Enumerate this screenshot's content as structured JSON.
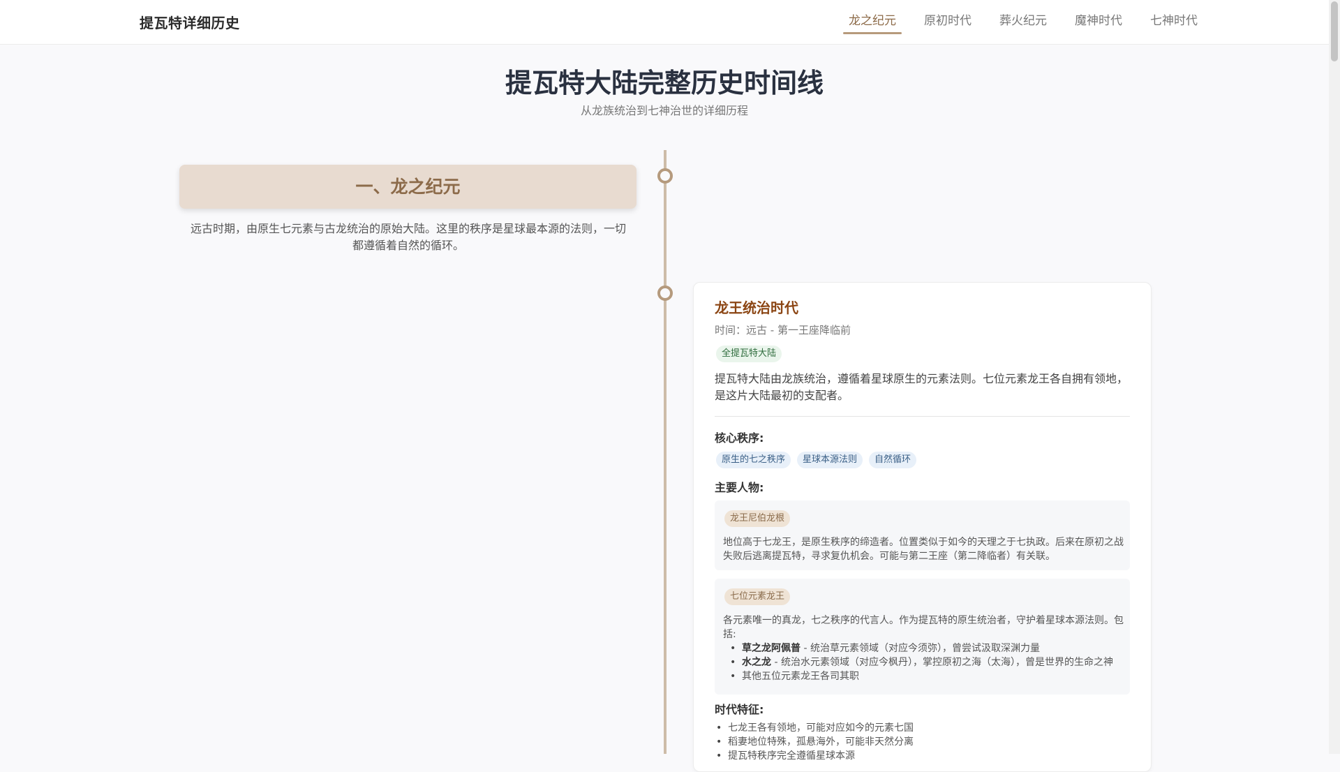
{
  "header": {
    "brand": "提瓦特详细历史",
    "nav": [
      {
        "label": "龙之纪元",
        "active": true
      },
      {
        "label": "原初时代",
        "active": false
      },
      {
        "label": "葬火纪元",
        "active": false
      },
      {
        "label": "魔神时代",
        "active": false
      },
      {
        "label": "七神时代",
        "active": false
      }
    ]
  },
  "page": {
    "title": "提瓦特大陆完整历史时间线",
    "subtitle": "从龙族统治到七神治世的详细历程"
  },
  "era": {
    "title": "一、龙之纪元",
    "description": "远古时期，由原生七元素与古龙统治的原始大陆。这里的秩序是星球最本源的法则，一切都遵循着自然的循环。"
  },
  "event": {
    "title": "龙王统治时代",
    "time": "时间：远古 - 第一王座降临前",
    "location": "全提瓦特大陆",
    "description": "提瓦特大陆由龙族统治，遵循着星球原生的元素法则。七位元素龙王各自拥有领地，是这片大陆最初的支配者。",
    "core_order_label": "核心秩序:",
    "core_order": [
      "原生的七之秩序",
      "星球本源法则",
      "自然循环"
    ],
    "figures_label": "主要人物:",
    "figures": [
      {
        "name": "龙王尼伯龙根",
        "text": "地位高于七龙王，是原生秩序的缔造者。位置类似于如今的天理之于七执政。后来在原初之战失败后逃离提瓦特，寻求复仇机会。可能与第二王座（第二降临者）有关联。"
      },
      {
        "name": "七位元素龙王",
        "text": "各元素唯一的真龙，七之秩序的代言人。作为提瓦特的原生统治者，守护着星球本源法则。包括:",
        "list": [
          {
            "bold": "草之龙阿佩普",
            "rest": " - 统治草元素领域（对应今须弥），曾尝试汲取深渊力量"
          },
          {
            "bold": "水之龙",
            "rest": " - 统治水元素领域（对应今枫丹），掌控原初之海（太海），曾是世界的生命之神"
          },
          {
            "bold": "",
            "rest": "其他五位元素龙王各司其职"
          }
        ]
      }
    ],
    "features_label": "时代特征:",
    "features": [
      "七龙王各有领地，可能对应如今的元素七国",
      "稻妻地位特殊，孤悬海外，可能非天然分离",
      "提瓦特秩序完全遵循星球本源"
    ]
  },
  "colors": {
    "accent": "#8c6a48",
    "era_bg": "#e8dbd0",
    "event_title": "#8b4513",
    "timeline": "#cdbca8"
  }
}
